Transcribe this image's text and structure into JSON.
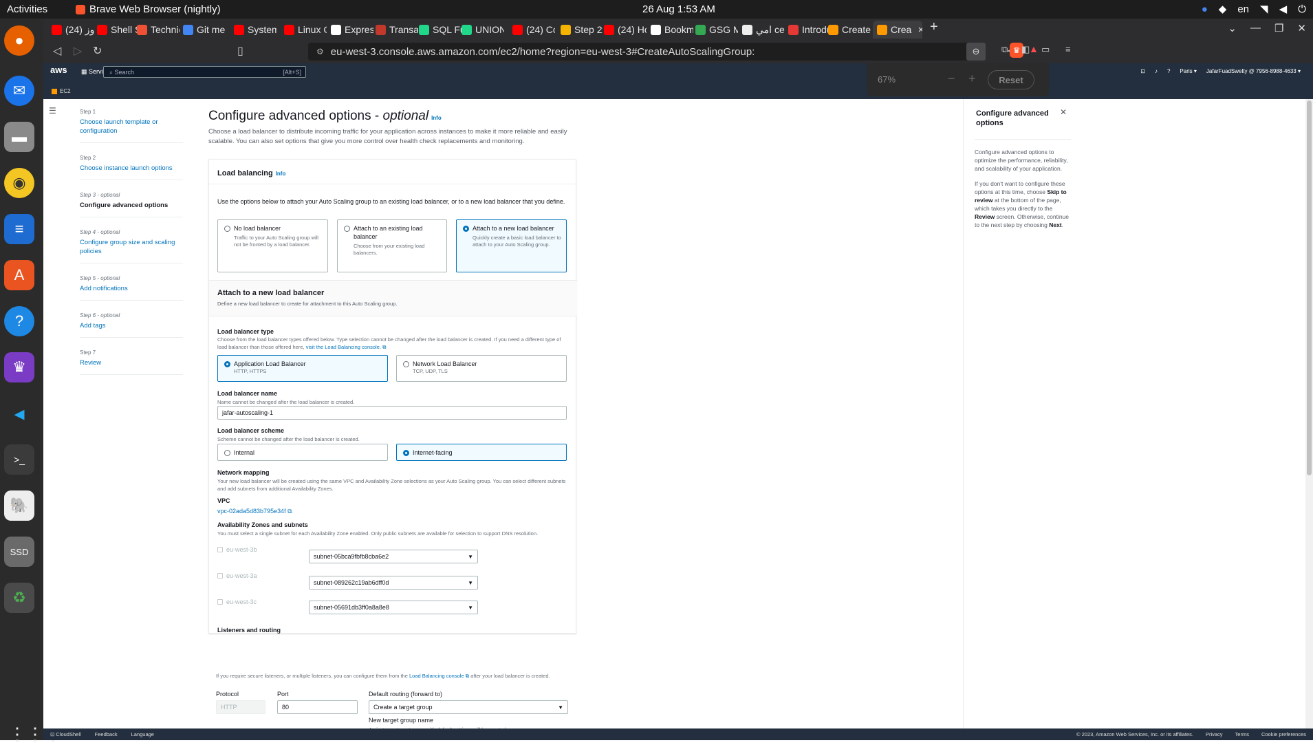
{
  "system": {
    "activities": "Activities",
    "app_name": "Brave Web Browser (nightly)",
    "clock": "26 Aug  1:53 AM",
    "lang": "en"
  },
  "tabs": [
    "دوز (24)",
    "Shell Sc",
    "Technic",
    "Git mer",
    "System",
    "Linux C",
    "Expres",
    "Transac",
    "SQL Fu",
    "UNION",
    "(24) Co",
    "Step 2:",
    "(24) Ho",
    "Bookm",
    "GSG Me",
    "امي ce",
    "Introdu",
    "Create",
    "Crea"
  ],
  "tab_colors": [
    "#ff0000",
    "#ff0000",
    "#f05033",
    "#4285f4",
    "#ff0000",
    "#ff0000",
    "#ffffff",
    "#c0392b",
    "#21d789",
    "#21d789",
    "#ff0000",
    "#f4b400",
    "#ff0000",
    "#ffffff",
    "#34a853",
    "#eeeeee",
    "#e53935",
    "#ff9900",
    "#ff9900"
  ],
  "url": "eu-west-3.console.aws.amazon.com/ec2/home?region=eu-west-3#CreateAutoScalingGroup:",
  "zoom": {
    "percent": "67%",
    "minus": "−",
    "plus": "+",
    "reset": "Reset"
  },
  "aws": {
    "logo": "aws",
    "services": "Services",
    "search_placeholder": "Search",
    "search_hint": "[Alt+S]",
    "region": "Paris ▾",
    "account": "JafarFuadSwelty @ 7956-8988-4633 ▾",
    "service_crumb": "EC2"
  },
  "steps": [
    {
      "label": "Step 1",
      "name": "Choose launch template or configuration"
    },
    {
      "label": "Step 2",
      "name": "Choose instance launch options"
    },
    {
      "label": "Step 3 - optional",
      "name": "Configure advanced options"
    },
    {
      "label": "Step 4 - optional",
      "name": "Configure group size and scaling policies"
    },
    {
      "label": "Step 5 - optional",
      "name": "Add notifications"
    },
    {
      "label": "Step 6 - optional",
      "name": "Add tags"
    },
    {
      "label": "Step 7",
      "name": "Review"
    }
  ],
  "page": {
    "title": "Configure advanced options - ",
    "title_optional": "optional",
    "info": "Info",
    "intro": "Choose a load balancer to distribute incoming traffic for your application across instances to make it more reliable and easily scalable. You can also set options that give you more control over health check replacements and monitoring."
  },
  "load_balancing": {
    "title": "Load balancing",
    "info": "Info",
    "description": "Use the options below to attach your Auto Scaling group to an existing load balancer, or to a new load balancer that you define.",
    "options": [
      {
        "title": "No load balancer",
        "desc": "Traffic to your Auto Scaling group will not be fronted by a load balancer."
      },
      {
        "title": "Attach to an existing load balancer",
        "desc": "Choose from your existing load balancers."
      },
      {
        "title": "Attach to a new load balancer",
        "desc": "Quickly create a basic load balancer to attach to your Auto Scaling group."
      }
    ]
  },
  "new_lb": {
    "title": "Attach to a new load balancer",
    "subtitle": "Define a new load balancer to create for attachment to this Auto Scaling group.",
    "type_label": "Load balancer type",
    "type_desc": "Choose from the load balancer types offered below. Type selection cannot be changed after the load balancer is created. If you need a different type of load balancer than those offered here, ",
    "type_link": "visit the Load Balancing console.",
    "types": [
      {
        "title": "Application Load Balancer",
        "desc": "HTTP, HTTPS"
      },
      {
        "title": "Network Load Balancer",
        "desc": "TCP, UDP, TLS"
      }
    ],
    "name_label": "Load balancer name",
    "name_desc": "Name cannot be changed after the load balancer is created.",
    "name_value": "jafar-autoscaling-1",
    "scheme_label": "Load balancer scheme",
    "scheme_desc": "Scheme cannot be changed after the load balancer is created.",
    "schemes": [
      "Internal",
      "Internet-facing"
    ],
    "network_label": "Network mapping",
    "network_desc": "Your new load balancer will be created using the same VPC and Availability Zone selections as your Auto Scaling group. You can select different subnets and add subnets from additional Availability Zones.",
    "vpc_label": "VPC",
    "vpc_value": "vpc-02ada5d83b795e34f",
    "az_label": "Availability Zones and subnets",
    "az_desc": "You must select a single subnet for each Availability Zone enabled. Only public subnets are available for selection to support DNS resolution.",
    "zones": [
      {
        "zone": "eu-west-3b",
        "subnet": "subnet-05bca9fbfb8cba6e2"
      },
      {
        "zone": "eu-west-3a",
        "subnet": "subnet-089262c19ab6dff0d"
      },
      {
        "zone": "eu-west-3c",
        "subnet": "subnet-05691db3ff0a8a8e8"
      }
    ],
    "listeners_label": "Listeners and routing",
    "listeners_desc_1": "If you require secure listeners, or multiple listeners, you can configure them from the ",
    "listeners_link": "Load Balancing console",
    "listeners_desc_2": " after your load balancer is created.",
    "protocol_label": "Protocol",
    "protocol_value": "HTTP",
    "port_label": "Port",
    "port_value": "80",
    "routing_label": "Default routing (forward to)",
    "routing_value": "Create a target group",
    "tg_label": "New target group name",
    "tg_desc": "An instance target group with default settings will be created."
  },
  "help": {
    "title": "Configure advanced options",
    "p1": "Configure advanced options to optimize the performance, reliability, and scalability of your application.",
    "p2_a": "If you don't want to configure these options at this time, choose ",
    "p2_b": "Skip to review",
    "p2_c": " at the bottom of the page, which takes you directly to the ",
    "p2_d": "Review",
    "p2_e": " screen. Otherwise, continue to the next step by choosing ",
    "p2_f": "Next",
    "p2_g": "."
  },
  "footer": {
    "cloudshell": "CloudShell",
    "feedback": "Feedback",
    "language": "Language",
    "copyright": "© 2023, Amazon Web Services, Inc. or its affiliates.",
    "privacy": "Privacy",
    "terms": "Terms",
    "cookies": "Cookie preferences"
  }
}
